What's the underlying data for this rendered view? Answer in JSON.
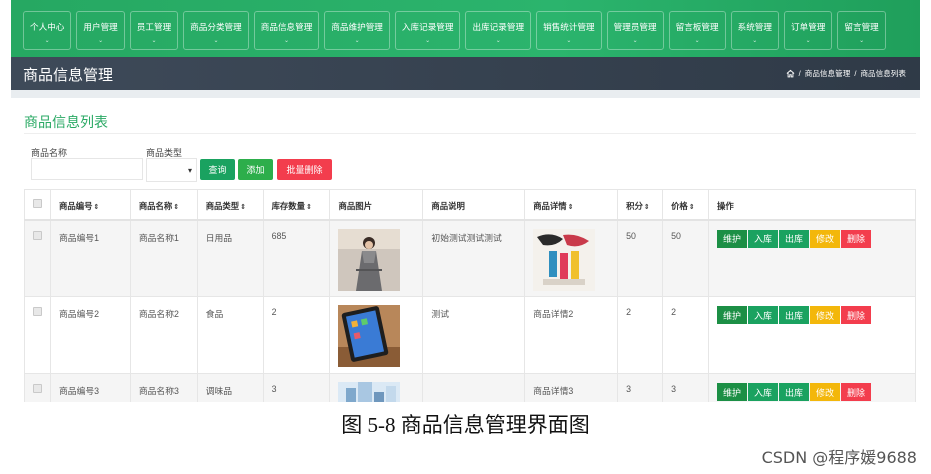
{
  "nav": {
    "items": [
      {
        "label": "个人中心"
      },
      {
        "label": "用户管理"
      },
      {
        "label": "员工管理"
      },
      {
        "label": "商品分类管理"
      },
      {
        "label": "商品信息管理"
      },
      {
        "label": "商品维护管理"
      },
      {
        "label": "入库记录管理"
      },
      {
        "label": "出库记录管理"
      },
      {
        "label": "销售统计管理"
      },
      {
        "label": "管理员管理"
      },
      {
        "label": "留言板管理"
      },
      {
        "label": "系统管理"
      },
      {
        "label": "订单管理"
      },
      {
        "label": "留言管理"
      }
    ],
    "caret": "⌄",
    "bg_color": "#28ac66"
  },
  "header": {
    "title": "商品信息管理",
    "breadcrumb": [
      "商品信息管理",
      "商品信息列表"
    ],
    "separator": "/",
    "home_icon": "home-icon"
  },
  "section": {
    "title": "商品信息列表",
    "title_color": "#2aa964"
  },
  "search": {
    "name_label": "商品名称",
    "name_value": "",
    "type_label": "商品类型",
    "type_value": "",
    "query_button": "查询",
    "add_button": "添加",
    "batch_delete_button": "批量删除"
  },
  "table": {
    "columns": [
      "商品编号",
      "商品名称",
      "商品类型",
      "库存数量",
      "商品图片",
      "商品说明",
      "商品详情",
      "积分",
      "价格",
      "操作"
    ],
    "sort_icon": "⇕",
    "rows": [
      {
        "code": "商品编号1",
        "name": "商品名称1",
        "type": "日用品",
        "stock": "685",
        "image": "product-photo-1",
        "desc": "初始测试测试测试",
        "detail": "",
        "detail_image": "product-detail-image-1",
        "points": "50",
        "price": "50"
      },
      {
        "code": "商品编号2",
        "name": "商品名称2",
        "type": "食品",
        "stock": "2",
        "image": "product-photo-2",
        "desc": "测试",
        "detail": "商品详情2",
        "detail_image": "",
        "points": "2",
        "price": "2"
      },
      {
        "code": "商品编号3",
        "name": "商品名称3",
        "type": "调味品",
        "stock": "3",
        "image": "product-photo-3",
        "desc": "",
        "detail": "商品详情3",
        "detail_image": "",
        "points": "3",
        "price": "3"
      }
    ],
    "actions": [
      "维护",
      "入库",
      "出库",
      "修改",
      "删除"
    ]
  },
  "caption": "图 5-8 商品信息管理界面图",
  "watermark": "CSDN @程序媛9688",
  "colors": {
    "primary_green": "#1aa260",
    "warning": "#f3b70b",
    "danger": "#f33d4d",
    "titlebar": "#37424f"
  }
}
